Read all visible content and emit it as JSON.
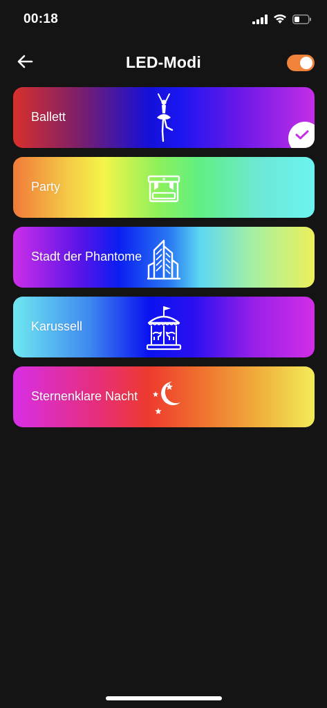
{
  "status_bar": {
    "time": "00:18",
    "icons": [
      "signal-icon",
      "wifi-icon",
      "battery-icon"
    ]
  },
  "header": {
    "title": "LED-Modi",
    "back_icon": "arrow-left-icon",
    "toggle_on": true,
    "toggle_color": "#f0833a"
  },
  "modes": [
    {
      "label": "Ballett",
      "icon": "ballerina-icon",
      "selected": true
    },
    {
      "label": "Party",
      "icon": "party-stage-icon",
      "selected": false
    },
    {
      "label": "Stadt der Phantome",
      "icon": "city-buildings-icon",
      "selected": false
    },
    {
      "label": "Karussell",
      "icon": "carousel-icon",
      "selected": false
    },
    {
      "label": "Sternenklare Nacht",
      "icon": "moon-stars-icon",
      "selected": false
    }
  ],
  "check_color": "#c42ee6"
}
